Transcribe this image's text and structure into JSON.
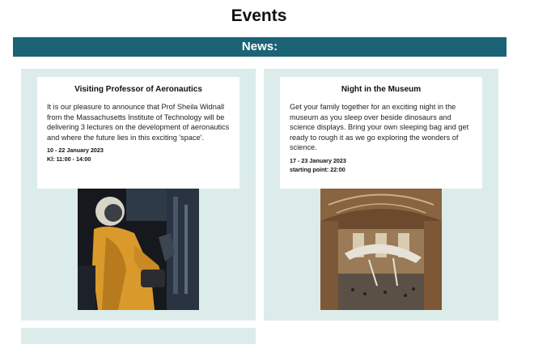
{
  "page": {
    "title": "Events"
  },
  "news_bar": {
    "label": "News:"
  },
  "events": [
    {
      "title": "Visiting Professor of Aeronautics",
      "description": "It is our pleasure to announce that Prof Sheila Widnall from the Massachusetts Institute of Technology will be delivering 3 lectures on the development of aeronautics and where the future lies in this exciting 'space'.",
      "date": "10 - 22 January 2023",
      "time": "Kl: 11:00 - 14:00",
      "image_icon": "astronaut-photo"
    },
    {
      "title": "Night in the Museum",
      "description": "Get your family together for an exciting night in the museum as you sleep over beside dinosaurs and science displays. Bring your own sleeping bag and get ready to rough it as we go exploring the wonders of science.",
      "date": "17 - 23 January 2023",
      "time": "starting point: 22:00",
      "image_icon": "museum-hall-photo"
    }
  ]
}
